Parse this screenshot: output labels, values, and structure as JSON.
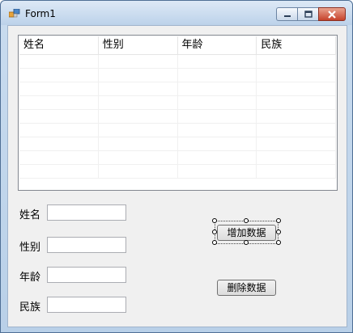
{
  "window": {
    "title": "Form1"
  },
  "grid": {
    "columns": [
      "姓名",
      "性别",
      "年龄",
      "民族"
    ],
    "empty_rows": 9
  },
  "form": {
    "name_label": "姓名",
    "gender_label": "性别",
    "age_label": "年龄",
    "ethnicity_label": "民族",
    "name_value": "",
    "gender_value": "",
    "age_value": "",
    "ethnicity_value": ""
  },
  "buttons": {
    "add_label": "增加数据",
    "delete_label": "删除数据"
  }
}
